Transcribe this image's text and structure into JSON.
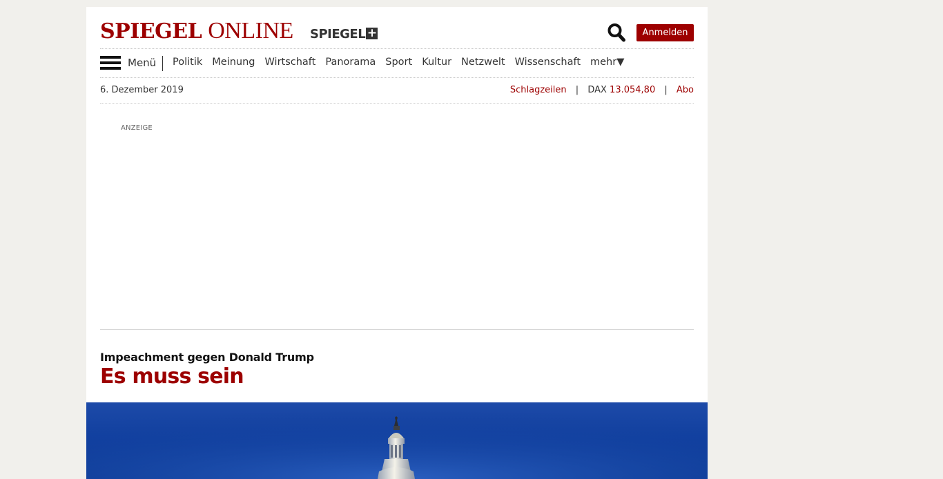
{
  "header": {
    "logo_bold": "SPIEGEL",
    "logo_rest": "ONLINE",
    "logo_plus": "SPIEGEL",
    "logo_plus_symbol": "+",
    "search_icon": "search-icon",
    "login_label": "Anmelden",
    "brand_color": "#9d0000"
  },
  "nav": {
    "menu_icon": "hamburger-icon",
    "menu_label": "Menü",
    "items": [
      "Politik",
      "Meinung",
      "Wirtschaft",
      "Panorama",
      "Sport",
      "Kultur",
      "Netzwelt",
      "Wissenschaft",
      "mehr▼"
    ]
  },
  "infobar": {
    "date": "6. Dezember 2019",
    "headlines_link": "Schlagzeilen",
    "sep": "|",
    "dax_label": "DAX",
    "dax_value": "13.054,80",
    "abo_link": "Abo"
  },
  "ad": {
    "label": "ANZEIGE"
  },
  "article": {
    "kicker": "Impeachment gegen Donald Trump",
    "headline": "Es muss sein",
    "image_subject": "capitol-dome-image"
  }
}
